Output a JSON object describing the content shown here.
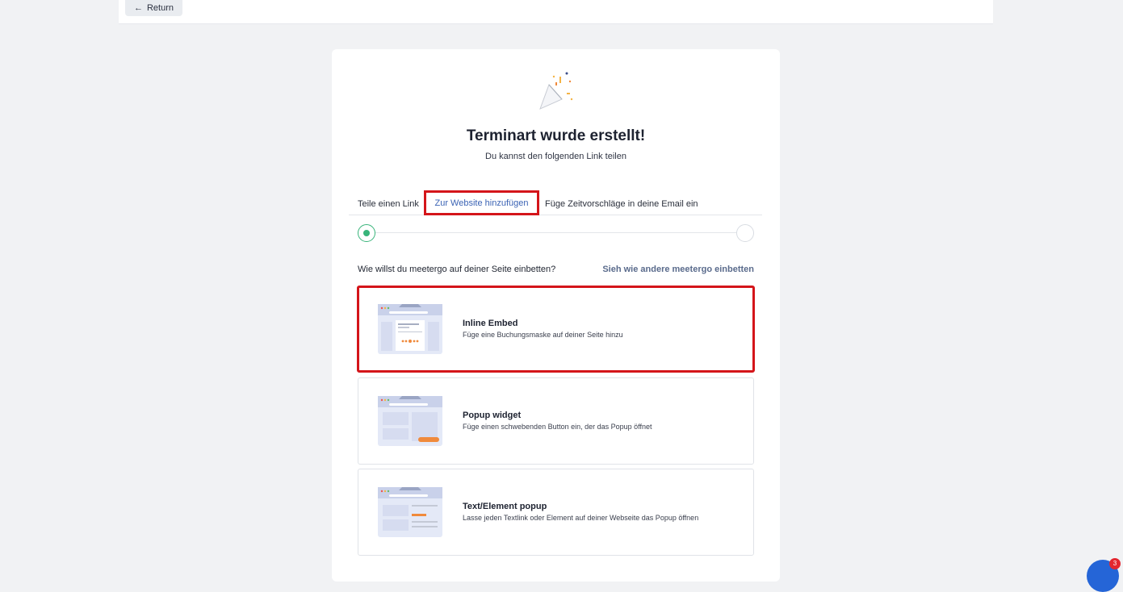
{
  "topbar": {
    "return_label": "Return",
    "return_icon": "arrow-left-icon"
  },
  "card": {
    "title": "Terminart wurde erstellt!",
    "subtitle": "Du kannst den folgenden Link teilen",
    "tabs": [
      {
        "label": "Teile einen Link",
        "active": false
      },
      {
        "label": "Zur Website hinzufügen",
        "active": true
      },
      {
        "label": "Füge Zeitvorschläge in deine Email ein",
        "active": false
      }
    ],
    "stepper": {
      "current_step": 1,
      "total_steps": 2
    },
    "question": "Wie willst du meetergo auf deiner Seite einbetten?",
    "see_link": "Sieh wie andere meetergo einbetten",
    "options": [
      {
        "title": "Inline Embed",
        "desc": "Füge eine Buchungsmaske auf deiner Seite hinzu",
        "selected": true
      },
      {
        "title": "Popup widget",
        "desc": "Füge einen schwebenden Button ein, der das Popup öffnet",
        "selected": false
      },
      {
        "title": "Text/Element popup",
        "desc": "Lasse jeden Textlink oder Element auf deiner Webseite das Popup öffnen",
        "selected": false
      }
    ]
  },
  "chat": {
    "badge_count": "3"
  },
  "colors": {
    "accent_link": "#3b63b4",
    "success": "#38b47a",
    "highlight": "#d4151a",
    "orange": "#f08a3c"
  }
}
